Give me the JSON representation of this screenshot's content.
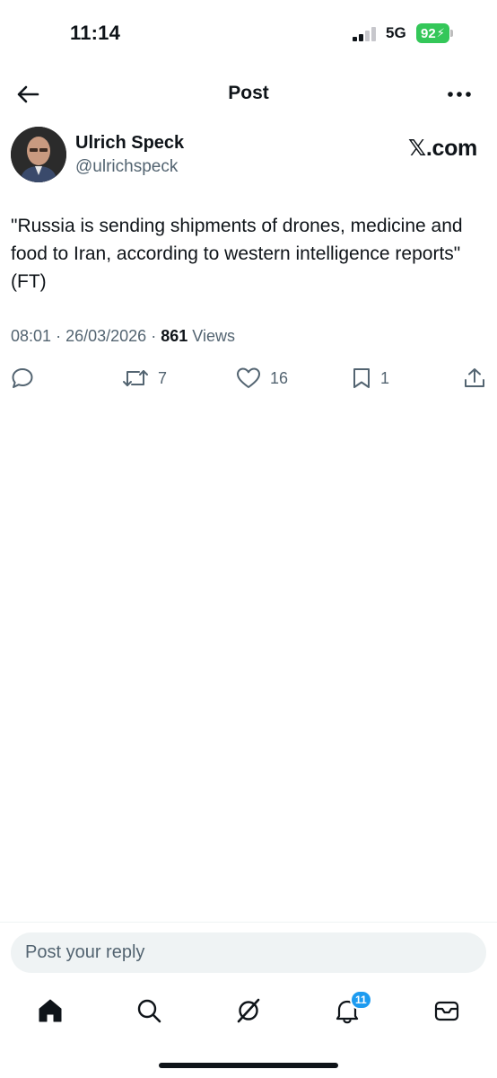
{
  "status_bar": {
    "time": "11:14",
    "network": "5G",
    "battery_level": "92",
    "battery_color": "#34c759",
    "icons": [
      "signal-icon",
      "battery-charging-icon"
    ]
  },
  "header": {
    "title": "Post",
    "icons": [
      "back-arrow-icon",
      "more-icon"
    ]
  },
  "author": {
    "name": "Ulrich Speck",
    "handle": "@ulrichspeck",
    "avatar_icon": "avatar"
  },
  "source": {
    "label": "𝕏.com"
  },
  "post": {
    "text": "\"Russia is sending shipments of drones, medicine and food to Iran, according to western intelligence reports\" (FT)",
    "time": "08:01",
    "date": "26/03/2026",
    "separator": "·",
    "views_count": "861",
    "views_label": "Views"
  },
  "actions": {
    "reply": {
      "icon": "reply-icon",
      "count": ""
    },
    "repost": {
      "icon": "repost-icon",
      "count": "7"
    },
    "like": {
      "icon": "heart-icon",
      "count": "16"
    },
    "bookmark": {
      "icon": "bookmark-icon",
      "count": "1"
    },
    "share": {
      "icon": "share-icon",
      "count": ""
    }
  },
  "reply_bar": {
    "placeholder": "Post your reply"
  },
  "bottom_nav": {
    "items": [
      "home-icon",
      "search-icon",
      "grok-icon",
      "notifications-icon",
      "messages-icon"
    ],
    "notifications_badge": "11",
    "badge_color": "#1d9bf0"
  },
  "colors": {
    "text_primary": "#0f1419",
    "text_secondary": "#536471",
    "accent": "#1d9bf0"
  }
}
